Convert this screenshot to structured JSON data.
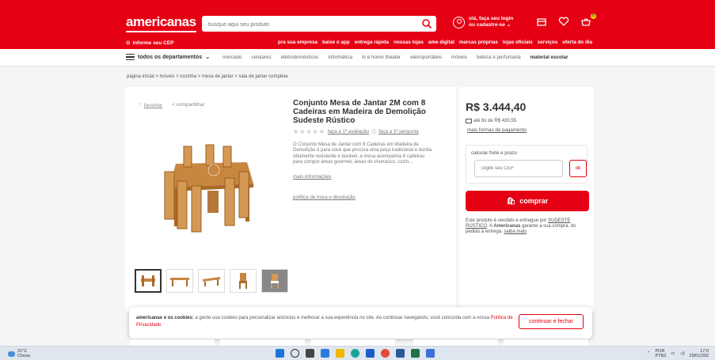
{
  "header": {
    "logo": "americanas",
    "search_placeholder": "busque aqui seu produto",
    "login_line1": "olá, faça seu login",
    "login_line2": "ou cadastre-se",
    "cart_count": "0",
    "cep_label": "informe seu CEP",
    "top_links": [
      "pra sua empresa",
      "baixe o app",
      "entrega rápida",
      "nossas lojas",
      "ame digital",
      "marcas próprias",
      "lojas oficiais",
      "serviços",
      "oferta do dia"
    ]
  },
  "nav": {
    "all_departments": "todos os departamentos",
    "links": [
      "mercado",
      "celulares",
      "eletrodomésticos",
      "informática",
      "tv e home theater",
      "eletroportáteis",
      "móveis",
      "beleza e perfumaria"
    ],
    "bold_link": "material escolar"
  },
  "breadcrumb": [
    "página inicial",
    "móveis",
    "cozinha",
    "mesa de jantar",
    "sala de jantar completa"
  ],
  "product": {
    "favorite": "favoritar",
    "share": "compartilhar",
    "title": "Conjunto Mesa de Jantar 2M com 8 Cadeiras em Madeira de Demolição Sudeste Rústico",
    "rate_link": "faça a 1ª avaliação",
    "question_link": "faça a 1ª pergunta",
    "description": "O Conjunto Mesa de Jantar com 8 Cadeiras em Madeira de Demolição é para você que procura uma peça tradicional e bonita. Altamente resistente e durável, a mesa acompanha 8 cadeiras para compor áreas gourmet, áreas de churrasco, cozin...",
    "more_info": "mais informações",
    "policy": "política de troca e devolução"
  },
  "buy": {
    "price": "R$ 3.444,40",
    "installments": "até 8x de R$ 430,55",
    "payment_ways": "mais formas de pagamento",
    "ship_label": "calcular frete e prazo",
    "cep_placeholder": "Digite seu CEP",
    "ok": "ok",
    "buy_label": "comprar",
    "seller_pre": "Este produto é vendido e entregue por",
    "seller_name": "SUDESTE RÚSTICO",
    "seller_mid": ". A",
    "seller_brand": "Americanas",
    "seller_post": "garante a sua compra, do pedido à entrega.",
    "seller_more": "saiba mais"
  },
  "cookie": {
    "title": "americanas e os cookies:",
    "text": "a gente usa cookies para personalizar anúncios e melhorar a sua experiência no site. Ao continuar navegando, você concorda com a nossa",
    "link": "Política de Privacidade",
    "end": ".",
    "button": "continuar e fechar"
  },
  "taskbar": {
    "temp": "21°C",
    "weather": "Chuva",
    "lang1": "POR",
    "lang2": "PTB2",
    "time": "17:0",
    "date": "29/01/202"
  },
  "colors": {
    "brand": "#e60014"
  }
}
